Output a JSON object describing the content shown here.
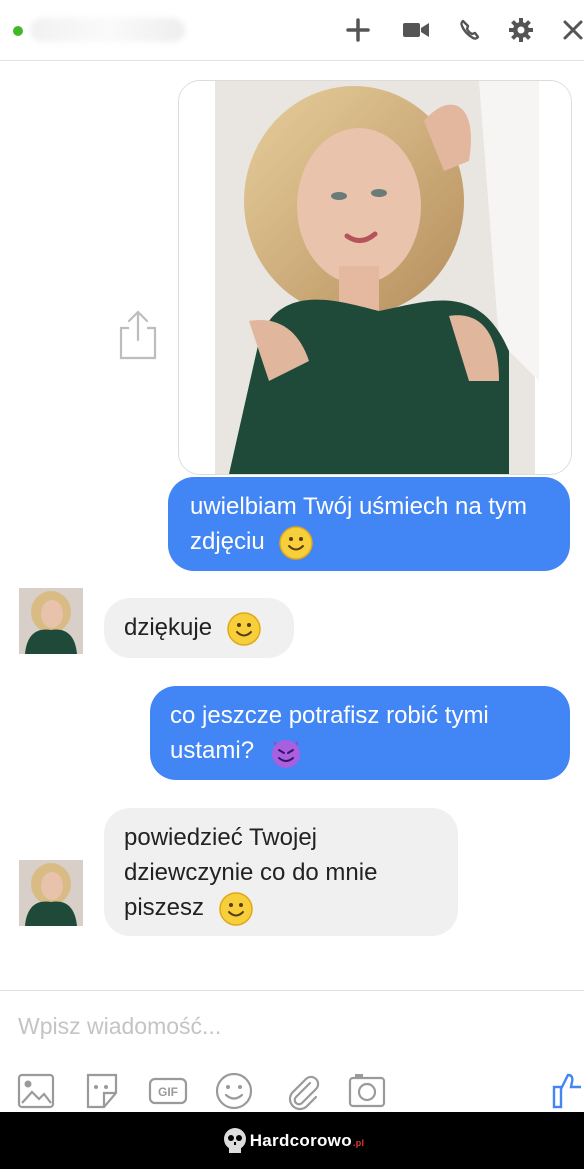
{
  "header": {
    "contact_name": "",
    "status": "online",
    "icons": [
      "add-icon",
      "video-call-icon",
      "phone-icon",
      "gear-icon",
      "close-icon"
    ]
  },
  "messages": [
    {
      "id": "m1",
      "from": "me",
      "type": "image",
      "alt": "photo"
    },
    {
      "id": "m2",
      "from": "me",
      "text": "uwielbiam Twój uśmiech na tym zdjęciu",
      "emoji": "smile"
    },
    {
      "id": "m3",
      "from": "them",
      "text": "dziękuje",
      "emoji": "smile"
    },
    {
      "id": "m4",
      "from": "me",
      "text": "co jeszcze potrafisz robić tymi ustami?",
      "emoji": "devil"
    },
    {
      "id": "m5",
      "from": "them",
      "text": "powiedzieć Twojej dziewczynie co do mnie piszesz",
      "emoji": "smile"
    }
  ],
  "composer": {
    "placeholder": "Wpisz wiadomość...",
    "tools": [
      "image-icon",
      "sticker-icon",
      "gif-icon",
      "emoji-icon",
      "attachment-icon",
      "camera-icon",
      "thumbs-up-icon"
    ],
    "gif_label": "GIF"
  },
  "footer": {
    "brand": "Hardcorowo",
    "brand_suffix": ".pl"
  },
  "colors": {
    "outgoing_bubble": "#4285f4",
    "incoming_bubble": "#f0f0f0",
    "online": "#42b72a"
  }
}
